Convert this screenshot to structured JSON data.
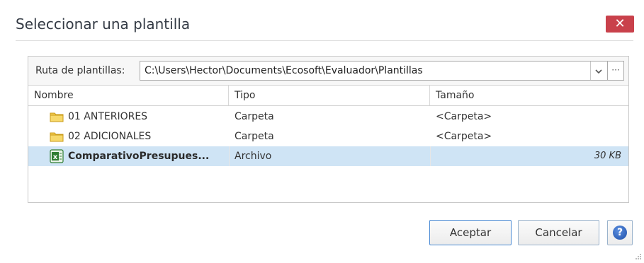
{
  "dialog": {
    "title": "Seleccionar una plantilla",
    "close_label": "✕"
  },
  "path": {
    "label": "Ruta de plantillas:",
    "value": "C:\\Users\\Hector\\Documents\\Ecosoft\\Evaluador\\Plantillas",
    "dropdown_icon": "chevron-down-icon",
    "more_label": "···"
  },
  "table": {
    "columns": [
      "Nombre",
      "Tipo",
      "Tamaño"
    ],
    "rows": [
      {
        "name": "01 ANTERIORES",
        "type": "Carpeta",
        "size": "<Carpeta>",
        "icon": "folder-icon"
      },
      {
        "name": "02 ADICIONALES",
        "type": "Carpeta",
        "size": "<Carpeta>",
        "icon": "folder-icon"
      },
      {
        "name": "ComparativoPresupues...",
        "type": "Archivo",
        "size": "30 KB",
        "icon": "excel-file-icon",
        "selected": true
      }
    ]
  },
  "buttons": {
    "accept": "Aceptar",
    "cancel": "Cancelar",
    "help_icon": "help-icon",
    "help_glyph": "?"
  },
  "colors": {
    "close": "#c9414b",
    "selection": "#cfe4f5",
    "accent": "#4a8ad4"
  }
}
